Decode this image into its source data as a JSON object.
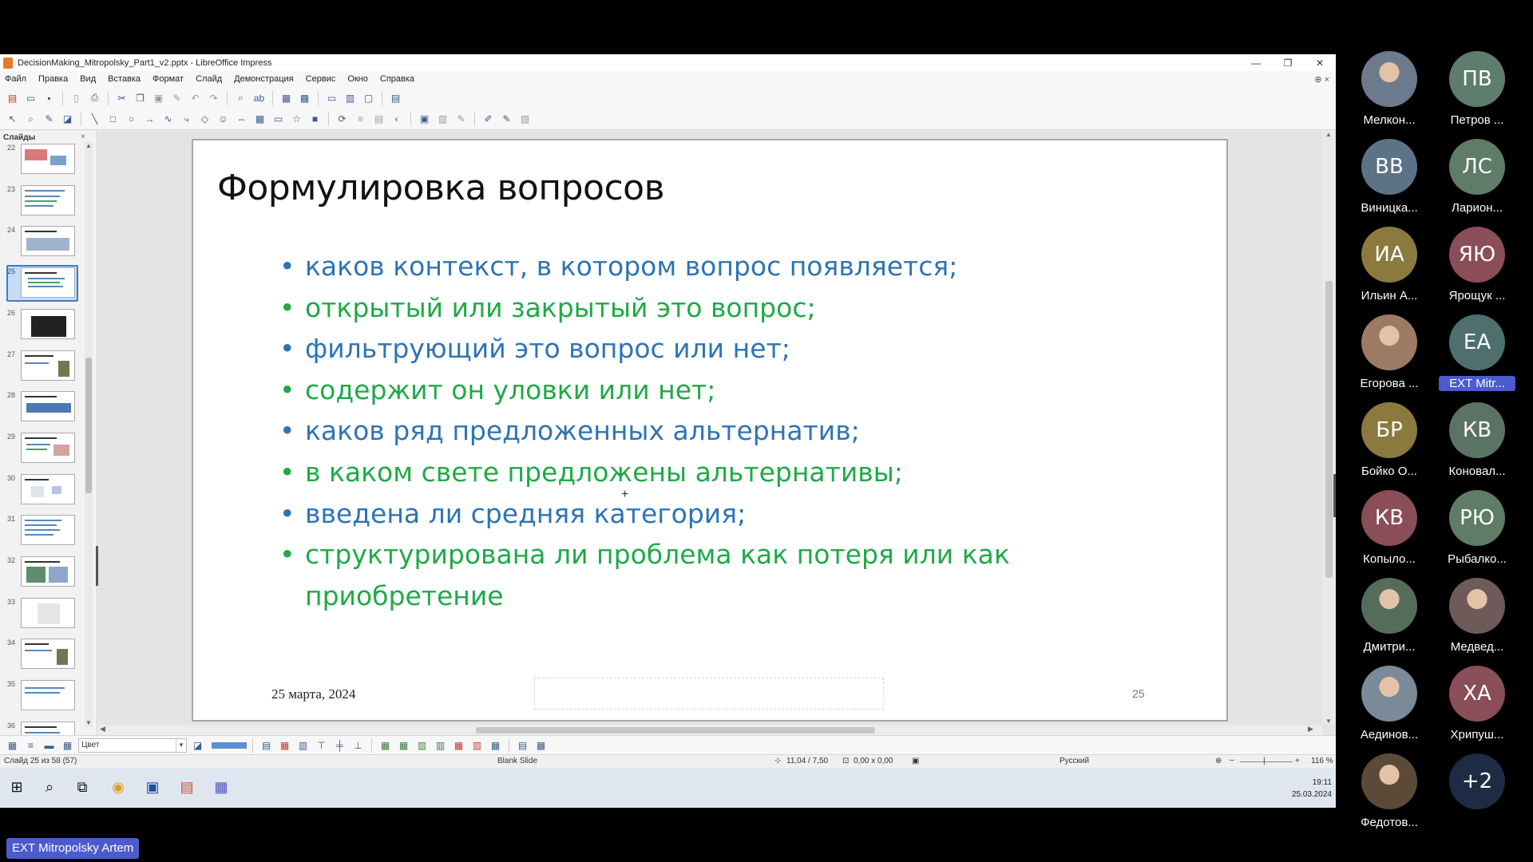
{
  "window": {
    "title": "DecisionMaking_Mitropolsky_Part1_v2.pptx - LibreOffice Impress",
    "minimize": "—",
    "restore": "❐",
    "close": "✕"
  },
  "menu": [
    "Файл",
    "Правка",
    "Вид",
    "Вставка",
    "Формат",
    "Слайд",
    "Демонстрация",
    "Сервис",
    "Окно",
    "Справка"
  ],
  "slide_panel": {
    "title": "Слайды",
    "close": "×",
    "thumbnails": [
      "22",
      "23",
      "24",
      "25",
      "26",
      "27",
      "28",
      "29",
      "30",
      "31",
      "32",
      "33",
      "34",
      "35",
      "36"
    ],
    "selected": "25"
  },
  "slide": {
    "title": "Формулировка вопросов",
    "bullets": [
      {
        "text": "каков контекст, в котором вопрос появляется;",
        "color": "#2e74b5"
      },
      {
        "text": "открытый или закрытый это вопрос;",
        "color": "#1faa47"
      },
      {
        "text": "фильтрующий это вопрос или нет;",
        "color": "#2e74b5"
      },
      {
        "text": "содержит он уловки или нет;",
        "color": "#1faa47"
      },
      {
        "text": "каков ряд предложенных альтернатив;",
        "color": "#2e74b5"
      },
      {
        "text": "в каком свете предложены альтернативы;",
        "color": "#1faa47"
      },
      {
        "text": "введена ли средняя категория;",
        "color": "#2e74b5"
      },
      {
        "text": "структурирована ли проблема как потеря или как приобретение",
        "color": "#1faa47"
      }
    ],
    "date": "25 марта, 2024",
    "number": "25"
  },
  "bottom_toolbar": {
    "color_select": "Цвет"
  },
  "status": {
    "slide_info": "Слайд 25 из 58 (57)",
    "layout": "Blank Slide",
    "position": "11,04 / 7,50",
    "size": "0,00 x 0,00",
    "language": "Русский",
    "zoom": "116 %"
  },
  "taskbar": {
    "time": "19:11",
    "date": "25.03.2024"
  },
  "participants": [
    {
      "initials": "",
      "name": "Мелкон...",
      "color": "#6b7b8c",
      "photo": true
    },
    {
      "initials": "ПВ",
      "name": "Петров ...",
      "color": "#5f7d6e",
      "photo": false
    },
    {
      "initials": "ВВ",
      "name": "Виницка...",
      "color": "#5c7287",
      "photo": false
    },
    {
      "initials": "ЛС",
      "name": "Ларион...",
      "color": "#5e7c66",
      "photo": false
    },
    {
      "initials": "ИА",
      "name": "Ильин А...",
      "color": "#8a7a3e",
      "photo": false
    },
    {
      "initials": "ЯЮ",
      "name": "Ярощук ...",
      "color": "#8a4e58",
      "photo": false
    },
    {
      "initials": "",
      "name": "Егорова ...",
      "color": "#9c7a64",
      "photo": true
    },
    {
      "initials": "ЕА",
      "name": "EXT Mitr...",
      "color": "#4e6f6e",
      "photo": false,
      "highlight": true
    },
    {
      "initials": "БР",
      "name": "Бойко О...",
      "color": "#8a7a3e",
      "photo": false
    },
    {
      "initials": "КВ",
      "name": "Коновал...",
      "color": "#5a7363",
      "photo": false
    },
    {
      "initials": "КВ",
      "name": "Копыло...",
      "color": "#8a4e58",
      "photo": false
    },
    {
      "initials": "РЮ",
      "name": "Рыбалко...",
      "color": "#5e7c66",
      "photo": false
    },
    {
      "initials": "",
      "name": "Дмитри...",
      "color": "#566c5a",
      "photo": true
    },
    {
      "initials": "",
      "name": "Медвед...",
      "color": "#6e5a58",
      "photo": true
    },
    {
      "initials": "",
      "name": "Аединов...",
      "color": "#7a8a98",
      "photo": true
    },
    {
      "initials": "ХА",
      "name": "Хрипуш...",
      "color": "#8a4e58",
      "photo": false
    },
    {
      "initials": "",
      "name": "Федотов...",
      "color": "#5c4a38",
      "photo": true
    },
    {
      "initials": "+2",
      "name": "",
      "color": "#1f2a44",
      "photo": false
    }
  ],
  "presenter_label": "EXT Mitropolsky Artem"
}
